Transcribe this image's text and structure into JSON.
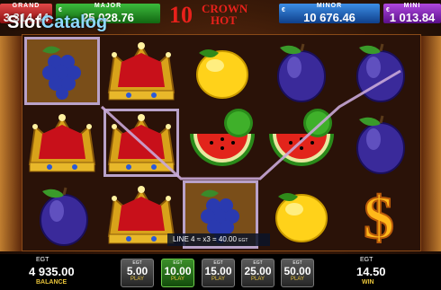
{
  "jackpots": {
    "grand": {
      "label": "GRAND",
      "value": "3 314.44"
    },
    "major": {
      "label": "MAJOR",
      "value": "25 028.76"
    },
    "minor": {
      "label": "MINOR",
      "value": "10 676.46"
    },
    "mini": {
      "label": "MINI",
      "value": "1 013.84"
    },
    "currency_symbol": "€"
  },
  "logo": {
    "number": "10",
    "word1": "CROWN",
    "word2": "HOT"
  },
  "watermark": {
    "part1": "Slot",
    "part2": "Catalog"
  },
  "line_info": {
    "text": "LINE 4",
    "multiplier": "x3 = 40.00",
    "brand": "EGT"
  },
  "balance": {
    "brand": "EGT",
    "value": "4 935.00",
    "label": "BALANCE"
  },
  "win": {
    "brand": "EGT",
    "value": "14.50",
    "label": "WIN"
  },
  "bets": [
    {
      "brand": "EGT",
      "value": "5.00",
      "label": "PLAY",
      "active": false
    },
    {
      "brand": "EGT",
      "value": "10.00",
      "label": "PLAY",
      "active": true
    },
    {
      "brand": "EGT",
      "value": "15.00",
      "label": "PLAY",
      "active": false
    },
    {
      "brand": "EGT",
      "value": "25.00",
      "label": "PLAY",
      "active": false
    },
    {
      "brand": "EGT",
      "value": "50.00",
      "label": "PLAY",
      "active": false
    }
  ],
  "reels": [
    [
      "grapes",
      "crown",
      "plum"
    ],
    [
      "crown",
      "crown",
      "crown"
    ],
    [
      "lemon",
      "watermelon",
      "grapes"
    ],
    [
      "plum",
      "watermelon",
      "lemon"
    ],
    [
      "plum",
      "plum",
      "dollar"
    ]
  ],
  "winning_cells": [
    [
      0,
      0
    ],
    [
      1,
      1
    ],
    [
      2,
      2
    ]
  ],
  "colors": {
    "grand": "#c21d1d",
    "major": "#1f8f1f",
    "minor": "#1f5fb8",
    "mini": "#7b22b0",
    "active_bet": "#2e7d1e"
  }
}
